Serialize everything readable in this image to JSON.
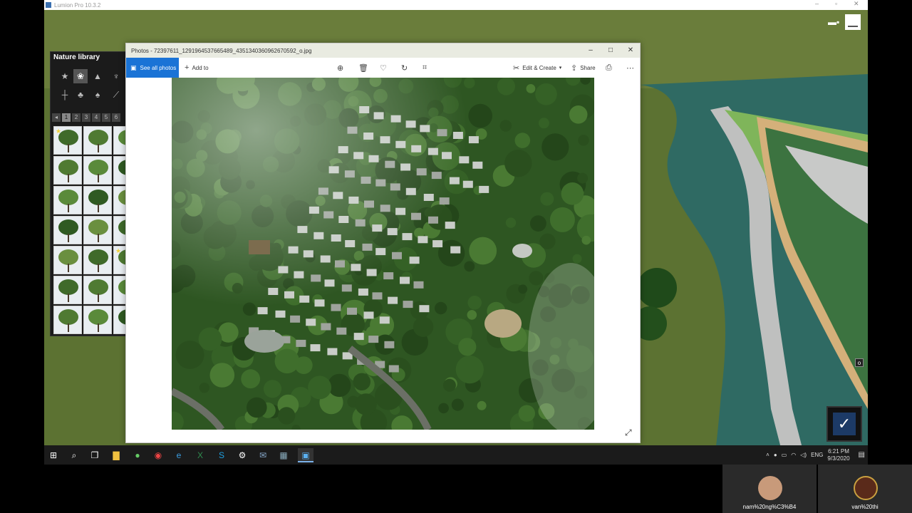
{
  "lumion": {
    "title": "Lumion Pro 10.3.2"
  },
  "nature_library": {
    "title": "Nature library",
    "pages": [
      "1",
      "2",
      "3",
      "4",
      "5",
      "6"
    ]
  },
  "photos": {
    "title": "Photos - 72397611_1291964537665489_4351340360962670592_o.jpg",
    "toolbar": {
      "see_all_label": "See all photos",
      "add_to_label": "Add to",
      "edit_create_label": "Edit & Create",
      "share_label": "Share"
    }
  },
  "taskbar": {
    "language": "ENG",
    "time": "6:21 PM",
    "date": "9/3/2020"
  },
  "participants": [
    {
      "name": "nam%20ng%C3%B4"
    },
    {
      "name": "van%20thi"
    }
  ],
  "colors": {
    "photos_accent": "#1a73d6",
    "lumion_terrain": "#5e7433"
  }
}
